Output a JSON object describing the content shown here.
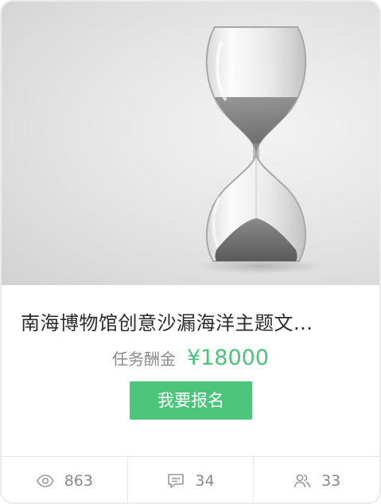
{
  "card": {
    "title": "南海博物馆创意沙漏海洋主题文...",
    "reward_label": "任务酬金",
    "reward_value": "¥18000",
    "apply_button": "我要报名",
    "image_icon": "hourglass-image",
    "colors": {
      "accent": "#4cc47a",
      "price": "#4ec27a",
      "muted": "#8a8a8a",
      "title": "#2b2b2b"
    }
  },
  "stats": [
    {
      "icon": "eye-icon",
      "value": "863"
    },
    {
      "icon": "comment-icon",
      "value": "34"
    },
    {
      "icon": "users-icon",
      "value": "33"
    }
  ]
}
